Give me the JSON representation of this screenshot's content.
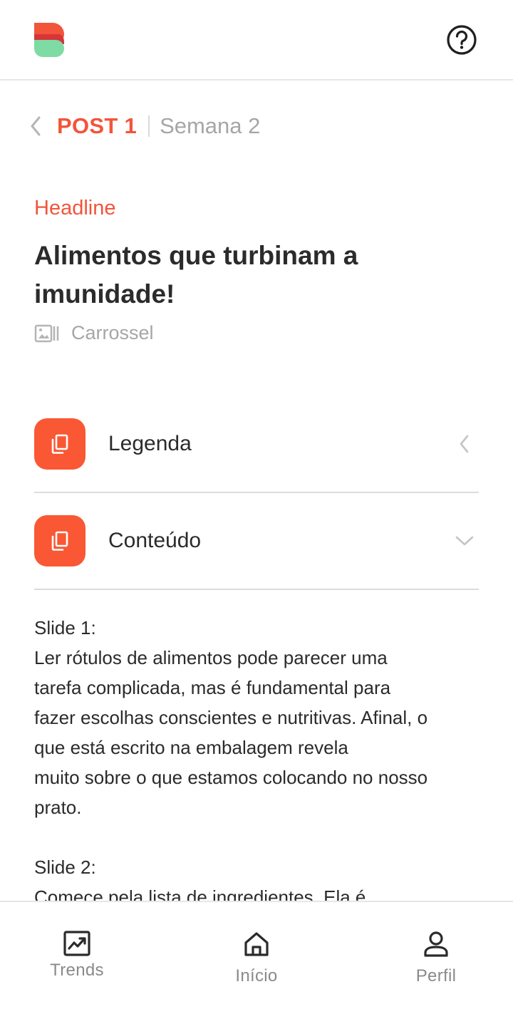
{
  "header": {
    "logo_icon": "brand-logo",
    "help_icon": "help-circle-icon",
    "colors": {
      "brand_orange": "#f2553a",
      "brand_red": "#e03c3c",
      "brand_green": "#7ddba3"
    }
  },
  "breadcrumb": {
    "back_icon": "chevron-left-icon",
    "post": "POST 1",
    "week": "Semana 2"
  },
  "post": {
    "section_label": "Headline",
    "title": "Alimentos que turbinam a imunidade!",
    "format_icon": "carousel-icon",
    "format": "Carrossel"
  },
  "accordion": [
    {
      "label": "Legenda",
      "icon": "copy-icon",
      "chevron": "chevron-left-icon",
      "expanded": false
    },
    {
      "label": "Conteúdo",
      "icon": "copy-icon",
      "chevron": "chevron-down-icon",
      "expanded": true
    }
  ],
  "content": {
    "slide1_title": "Slide 1:",
    "slide1_line1": "Ler rótulos de alimentos pode parecer uma",
    "slide1_line2": "tarefa complicada, mas é fundamental para",
    "slide1_line3": "fazer escolhas conscientes e nutritivas. Afinal, o",
    "slide1_line4": "que está escrito na embalagem revela",
    "slide1_line5": "muito sobre o que estamos colocando no nosso",
    "slide1_line6": "prato.",
    "slide2_title": "Slide 2:",
    "slide2_line1": "Comece pela lista de ingredientes. Ela é"
  },
  "bottom_nav": [
    {
      "label": "Trends",
      "icon": "trending-up-icon"
    },
    {
      "label": "Início",
      "icon": "home-icon"
    },
    {
      "label": "Perfil",
      "icon": "user-icon"
    }
  ]
}
